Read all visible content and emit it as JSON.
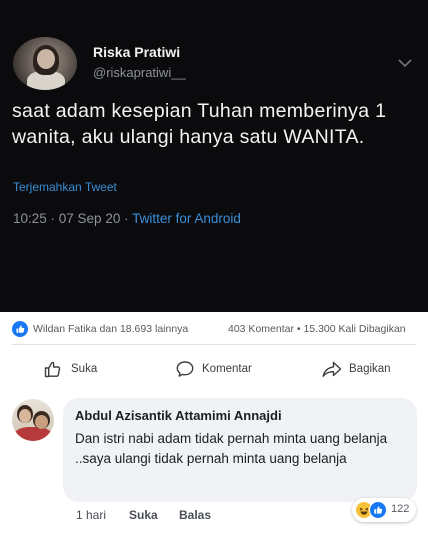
{
  "tweet": {
    "name": "Riska Pratiwi",
    "handle": "@riskapratiwi__",
    "text": "saat adam kesepian Tuhan memberinya 1 wanita, aku ulangi hanya satu WANITA.",
    "translate_label": "Terjemahkan Tweet",
    "timestamp": "10:25 · 07 Sep 20 · ",
    "via": "Twitter for Android"
  },
  "post_stats": {
    "reactors": "Wildan Fatika dan 18.693 lainnya",
    "counts": "403 Komentar • 15.300 Kali Dibagikan"
  },
  "actions": {
    "like": "Suka",
    "comment": "Komentar",
    "share": "Bagikan"
  },
  "comment": {
    "author": "Abdul Azisantik Attamimi Annajdi",
    "text": "Dan istri nabi adam tidak pernah minta uang belanja ..saya ulangi tidak pernah minta uang belanja",
    "time": "1 hari",
    "like_label": "Suka",
    "reply_label": "Balas",
    "reaction_count": "122",
    "reaction_icons": [
      "haha-icon",
      "like-icon"
    ]
  },
  "colors": {
    "tweet_bg": "#0b0b0d",
    "twitter_link": "#3a8fd8",
    "facebook_blue": "#1877f2",
    "comment_bubble": "#f0f2f5"
  }
}
